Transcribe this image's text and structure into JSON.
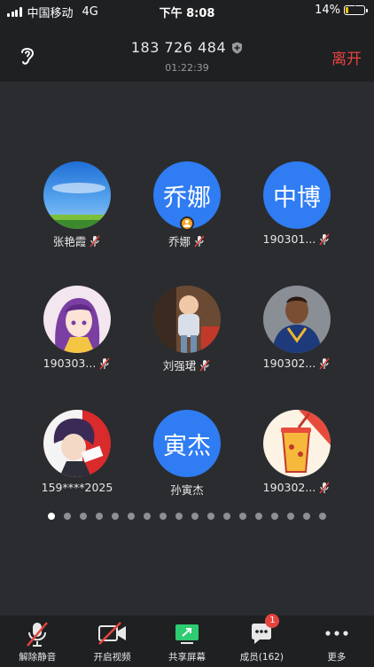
{
  "status_bar": {
    "carrier": "中国移动",
    "network": "4G",
    "time": "下午 8:08",
    "battery_percent": "14%",
    "battery_level": 0.14
  },
  "header": {
    "meeting_id": "183 726 484",
    "elapsed": "01:22:39",
    "leave_label": "离开",
    "leave_color": "#e6433f"
  },
  "participants": [
    {
      "name": "张艳霞",
      "avatar": "photo-sky",
      "muted": true
    },
    {
      "name": "乔娜",
      "avatar_text": "乔娜",
      "host": true,
      "muted": true
    },
    {
      "name": "190301...",
      "avatar_text": "中博",
      "muted": true
    },
    {
      "name": "190303...",
      "avatar": "photo-anime-girl",
      "muted": true
    },
    {
      "name": "刘强珺",
      "avatar": "photo-child",
      "muted": true
    },
    {
      "name": "190302...",
      "avatar": "photo-basketball",
      "muted": true
    },
    {
      "name": "159****2025",
      "avatar": "photo-anime-boy",
      "muted": false
    },
    {
      "name": "孙寅杰",
      "avatar_text": "寅杰",
      "muted": false
    },
    {
      "name": "190302...",
      "avatar": "photo-cartoon-drink",
      "muted": true
    }
  ],
  "pagination": {
    "pages": 18,
    "current": 1
  },
  "toolbar": {
    "unmute_label": "解除静音",
    "video_label": "开启视频",
    "share_label": "共享屏幕",
    "members_label": "成员(162)",
    "members_badge": "1",
    "more_label": "更多"
  },
  "colors": {
    "accent_blue": "#2f7cf3",
    "danger": "#e6433f",
    "share_green": "#2ecc71"
  }
}
